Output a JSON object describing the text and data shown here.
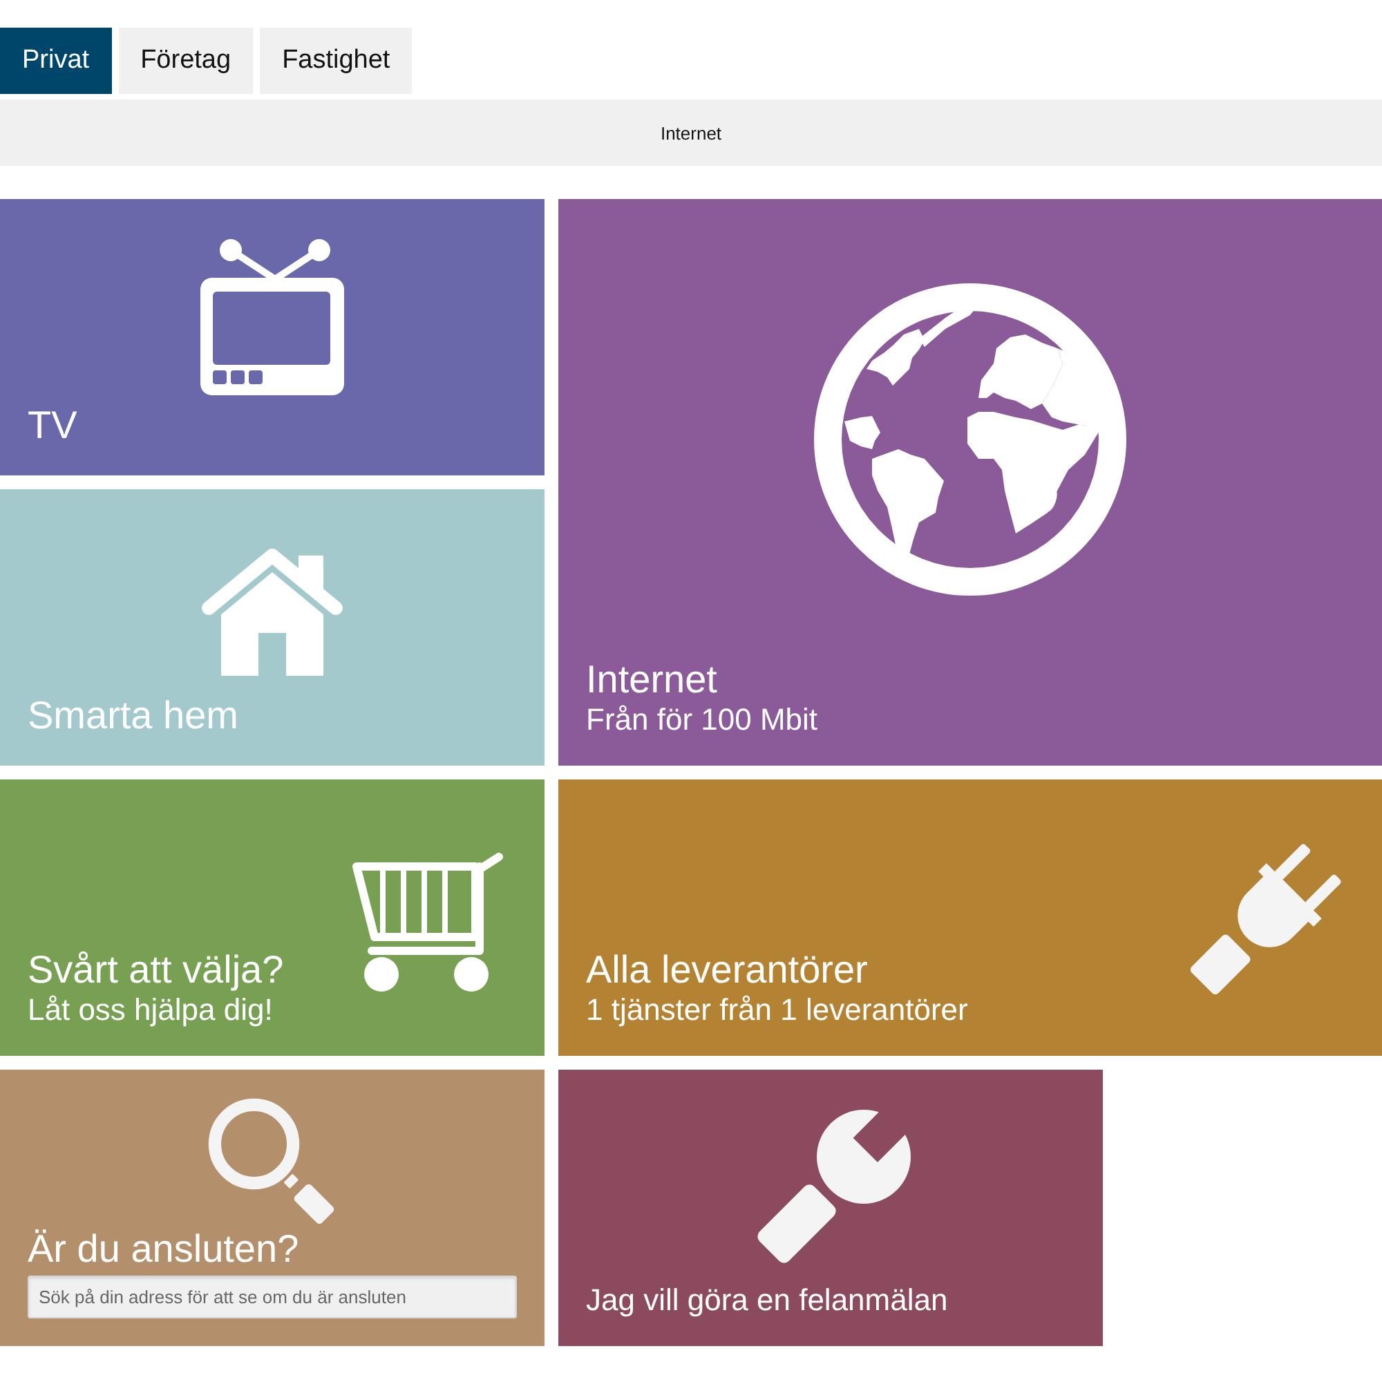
{
  "tabs": [
    {
      "label": "Privat",
      "selected": true
    },
    {
      "label": "Företag",
      "selected": false
    },
    {
      "label": "Fastighet",
      "selected": false
    }
  ],
  "subnav": {
    "links": [
      {
        "label": "Internet"
      }
    ]
  },
  "top_block": {
    "stack": [
      {
        "kind": "category",
        "title": "TV",
        "color": "#6868aa"
      },
      {
        "kind": "category",
        "title": "Smarta hem",
        "color": "#a3c9cc"
      }
    ],
    "feature": {
      "kind": "category",
      "title": "Internet",
      "subtitle": "Från för 100 Mbit",
      "color": "#8b5a98"
    }
  },
  "tiles": [
    {
      "kind": "category",
      "title": "Svårt att välja?",
      "subtitle": "Låt oss hjälpa dig!",
      "color": "#78a053"
    },
    {
      "kind": "category",
      "title": "Alla leverantörer",
      "subtitle": "1 tjänster från 1 leverantörer",
      "color": "#b38232"
    },
    {
      "kind": "search",
      "title": "Är du ansluten?",
      "field": {
        "placeholder": "Sök på din adress för att se om du är ansluten"
      },
      "color": "#b38f6b"
    },
    {
      "kind": "action",
      "label": "Jag vill göra en felanmälan",
      "color": "#8b4a5e"
    }
  ]
}
